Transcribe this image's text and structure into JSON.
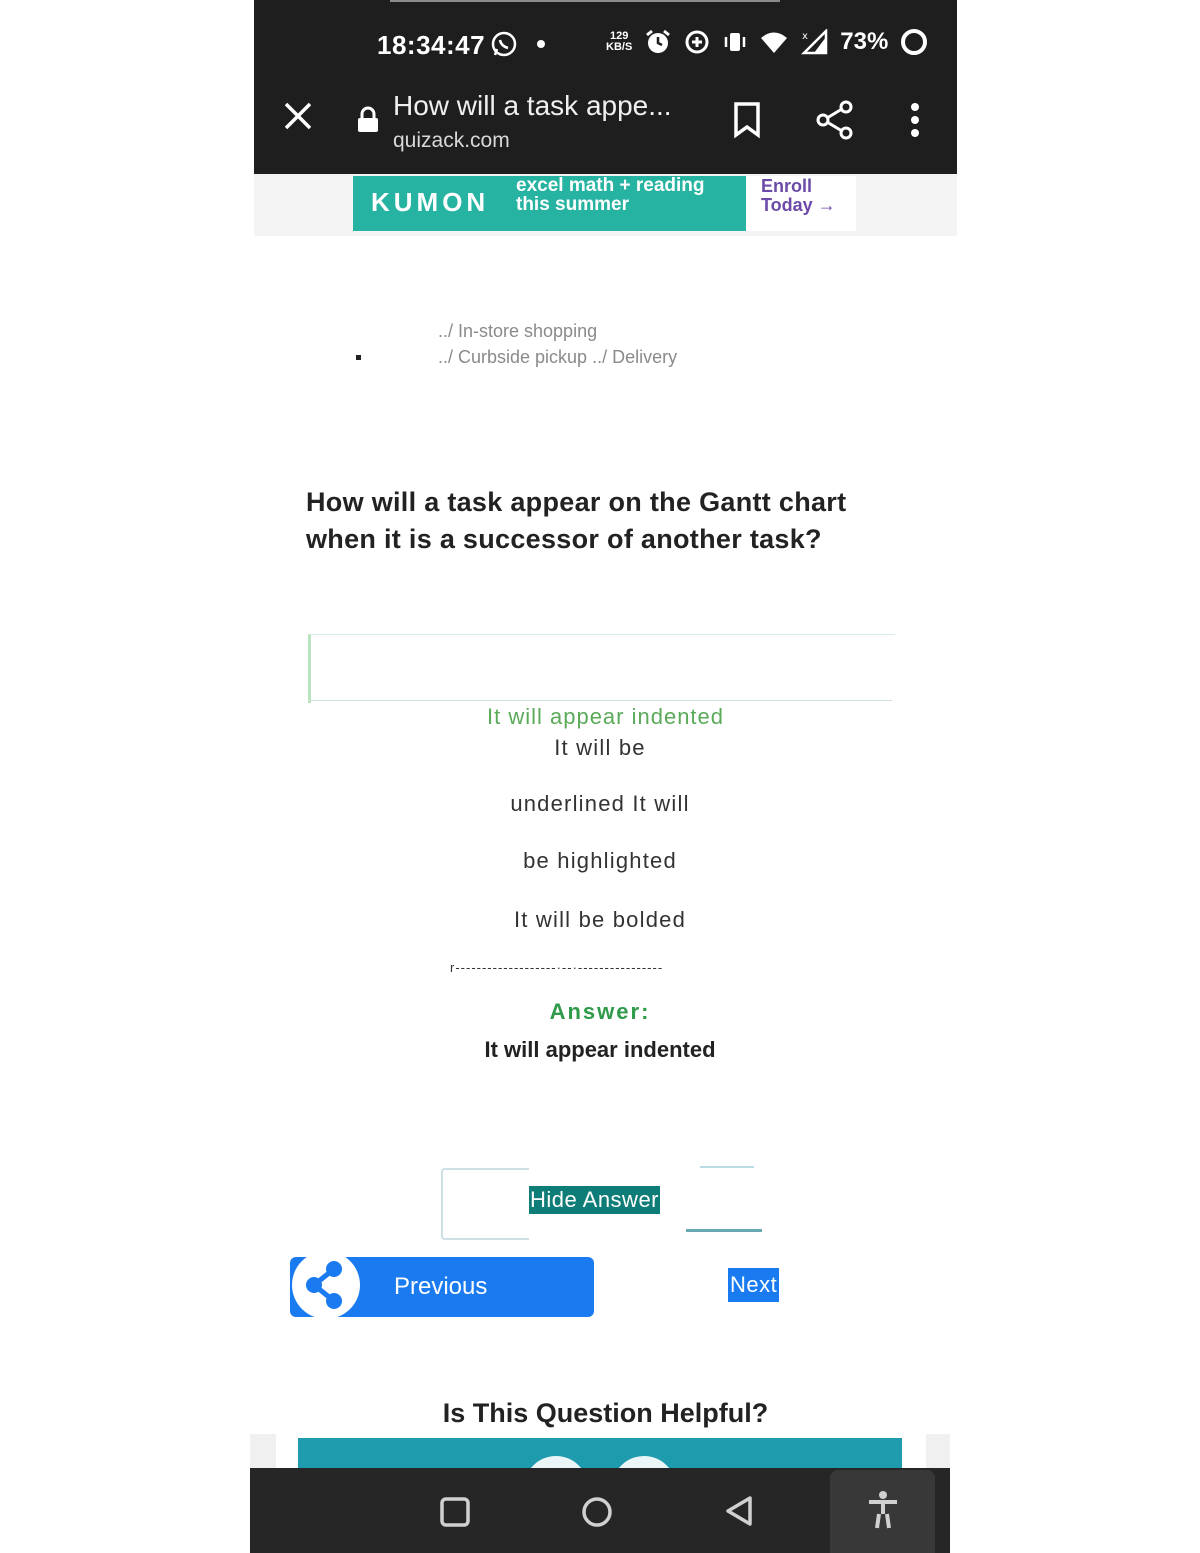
{
  "status_bar": {
    "time": "18:34:47",
    "speed_value": "129",
    "speed_unit": "KB/S",
    "battery": "73%",
    "icons": [
      "whatsapp-icon",
      "dot-icon",
      "alarm-icon",
      "data-saver-icon",
      "vibrate-icon",
      "wifi-icon",
      "signal-icon",
      "battery-ring-icon"
    ]
  },
  "browser": {
    "tab_title": "How will a task appe...",
    "domain": "quizack.com"
  },
  "ad": {
    "brand": "KUMON",
    "line1": "excel math + reading",
    "line2": "this summer",
    "cta1": "Enroll",
    "cta2": "Today →"
  },
  "delivery": {
    "line1": "../ In-store shopping",
    "line2": "../ Curbside pickup ../ Delivery"
  },
  "question": "How will a task appear on the Gantt chart when it is a successor of another task?",
  "options": {
    "correct": "It will appear indented",
    "line1": "It will be",
    "line2": "underlined It will",
    "line3": "be highlighted",
    "line4": "It will be bolded"
  },
  "separator": "r-------------------·--·----------------",
  "answer": {
    "label": "Answer:",
    "text": "It will appear indented"
  },
  "buttons": {
    "hide_answer": "Hide Answer",
    "previous": "Previous",
    "next": "Next"
  },
  "helpful": "Is This Question Helpful?",
  "colors": {
    "accent_green": "#2e9a4a",
    "button_blue": "#1a7bf0",
    "hide_teal": "#0e7d77",
    "ad_teal": "#27b3a1"
  }
}
